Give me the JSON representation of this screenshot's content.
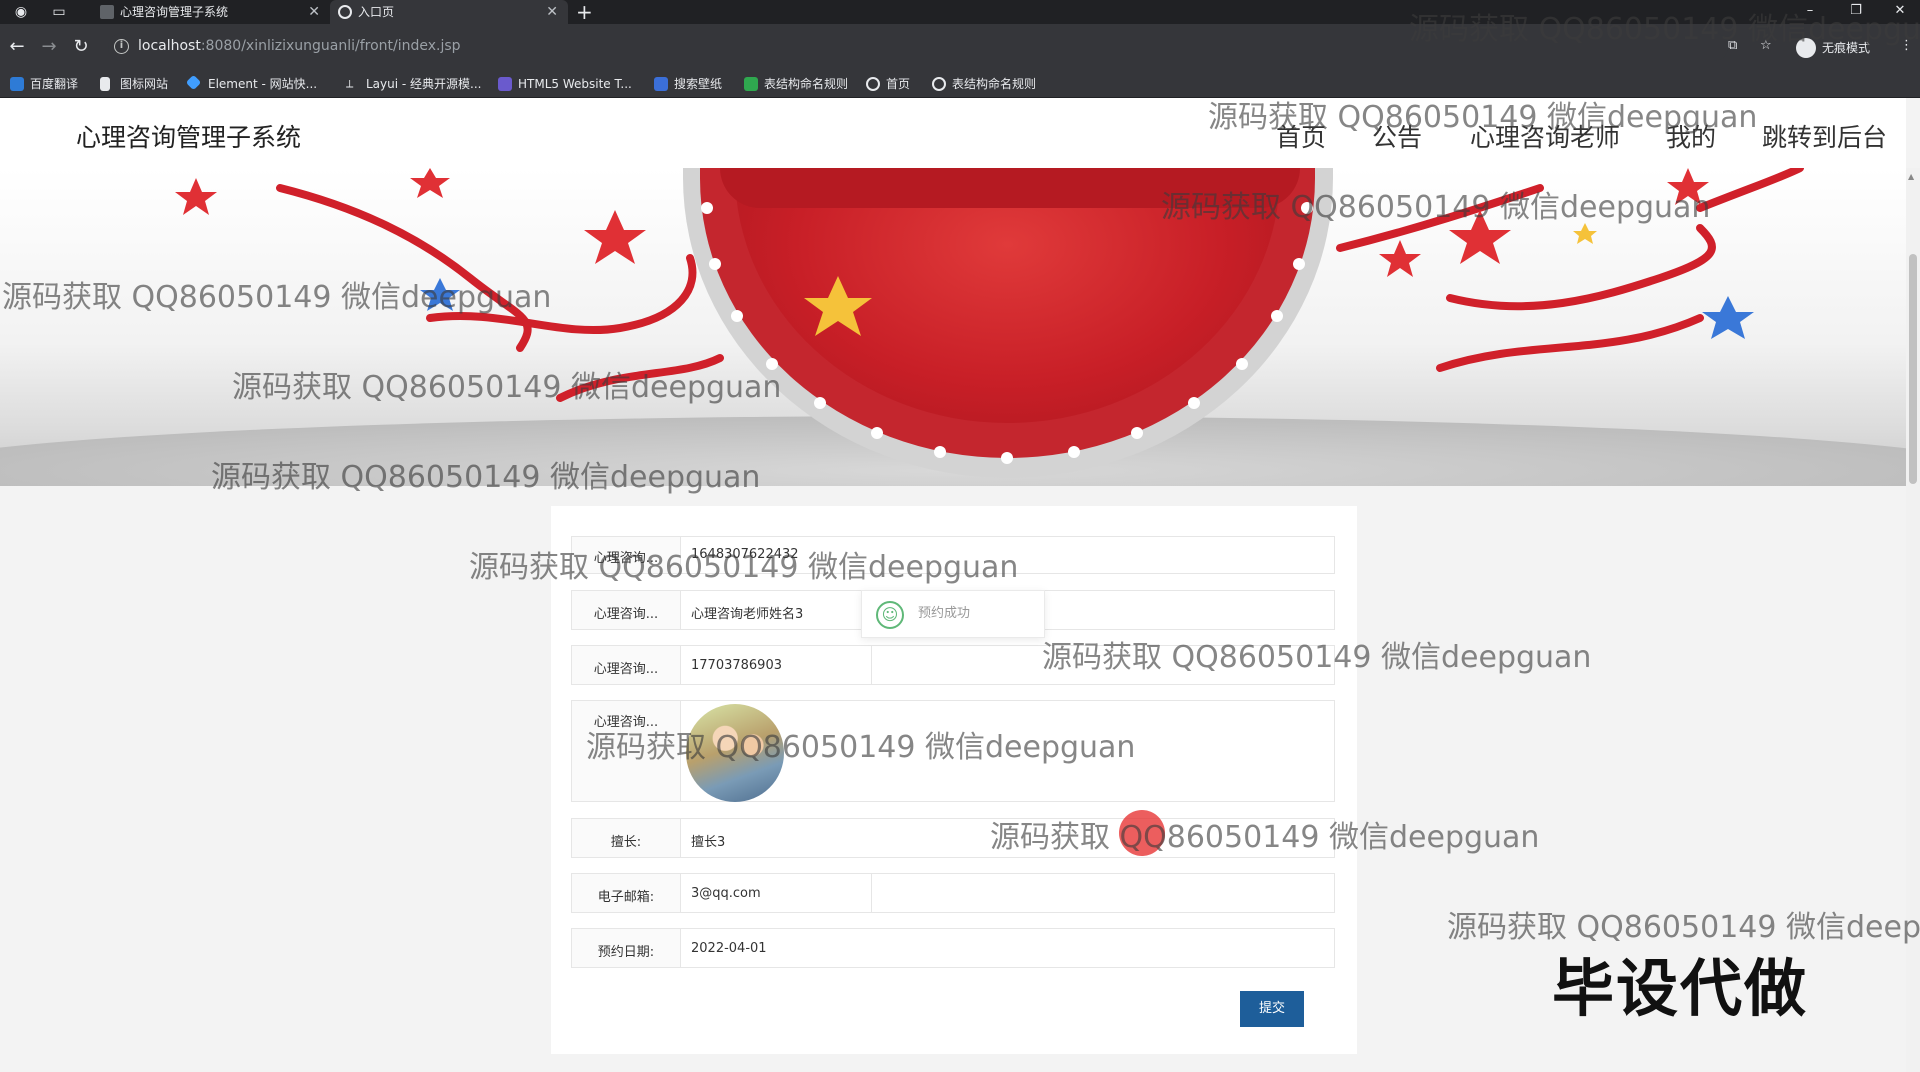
{
  "browser": {
    "tabs": [
      {
        "title": "心理咨询管理子系统",
        "active": false
      },
      {
        "title": "入口页",
        "active": true
      }
    ],
    "new_tab": "+",
    "url_host": "localhost",
    "url_rest": ":8080/xinlizixunguanli/front/index.jsp",
    "incognito_label": "无痕模式",
    "bookmarks": [
      "百度翻译",
      "图标网站",
      "Element - 网站快...",
      "Layui - 经典开源模...",
      "HTML5 Website T...",
      "搜索壁纸",
      "表结构命名规则",
      "首页",
      "表结构命名规则"
    ]
  },
  "site": {
    "title": "心理咨询管理子系统",
    "nav": [
      "首页",
      "公告",
      "心理咨询老师",
      "我的",
      "跳转到后台"
    ]
  },
  "form": {
    "rows": [
      {
        "label": "心理咨询...",
        "value": "1648307622432"
      },
      {
        "label": "心理咨询...",
        "value": "心理咨询老师姓名3"
      },
      {
        "label": "心理咨询...",
        "value": "17703786903"
      },
      {
        "label": "心理咨询...",
        "value": ""
      },
      {
        "label": "擅长:",
        "value": "擅长3"
      },
      {
        "label": "电子邮箱:",
        "value": "3@qq.com"
      },
      {
        "label": "预约日期:",
        "value": "2022-04-01"
      }
    ],
    "submit_label": "提交"
  },
  "toast": {
    "message": "预约成功"
  },
  "watermark_text": "源码获取 QQ86050149 微信deepguan",
  "stamp_text": "毕设代做",
  "colors": {
    "primary": "#1e5e9a",
    "banner_red": "#c81f27",
    "toast_icon": "#5fb878"
  }
}
